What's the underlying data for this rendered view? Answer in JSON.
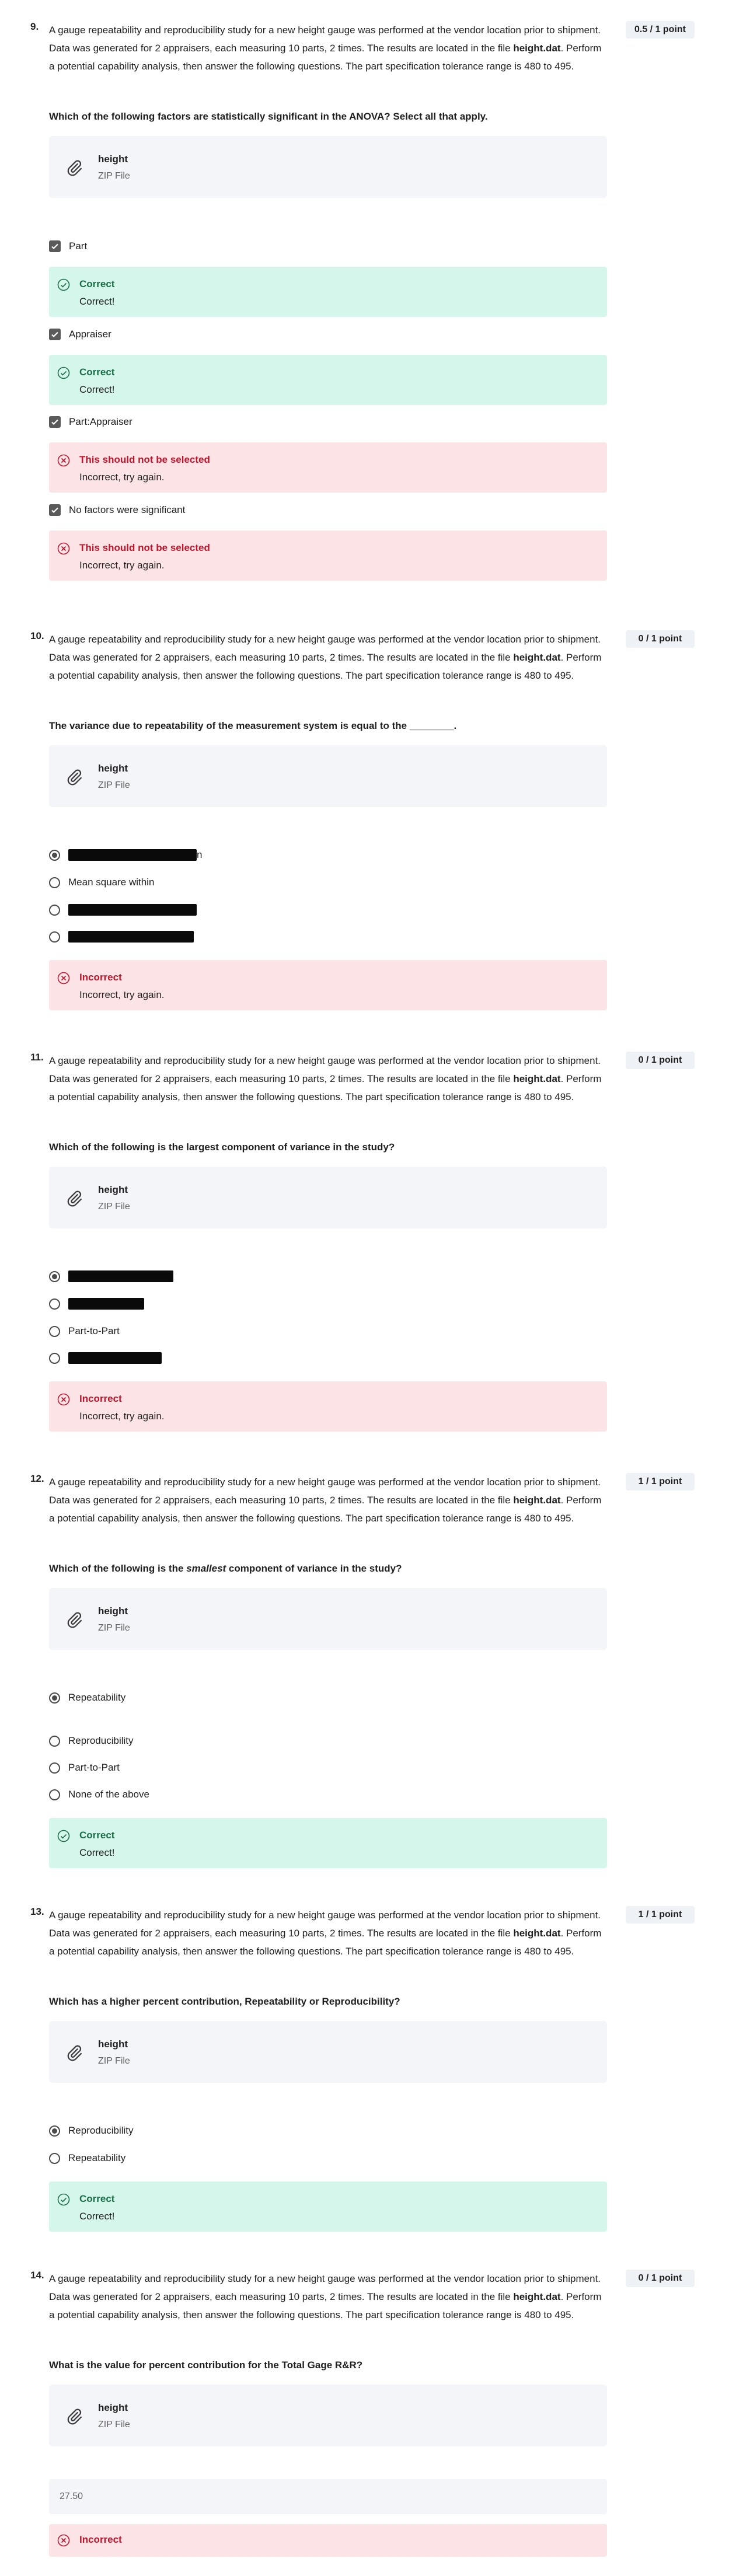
{
  "questions": [
    {
      "number": "9.",
      "score": "0.5 / 1 point",
      "stem": {
        "p1": "A gauge repeatability and reproducibility study for a new height gauge was performed at the vendor location prior to shipment. Data was generated for 2 appraisers, each measuring 10 parts, 2 times. The results are located in the file ",
        "file": "height.dat",
        "p2": ". Perform a potential capability analysis, then answer the following questions. The part specification tolerance range is 480 to 495."
      },
      "prompt": "Which of the following factors are statistically significant in the ANOVA? Select all that apply.",
      "attachment": {
        "name": "height",
        "type": "ZIP File",
        "icon": "paperclip-icon"
      },
      "options": [
        {
          "label": "Part",
          "checked": true
        },
        {
          "label": "Appraiser",
          "checked": true
        },
        {
          "label": "Part:Appraiser",
          "checked": true
        },
        {
          "label": "No factors were significant",
          "checked": true
        }
      ],
      "feedback": [
        {
          "title": "Correct",
          "message": "Correct!",
          "status": "correct"
        },
        {
          "title": "Correct",
          "message": "Correct!",
          "status": "correct"
        },
        {
          "title": "This should not be selected",
          "message": "Incorrect, try again.",
          "status": "incorrect"
        },
        {
          "title": "This should not be selected",
          "message": "Incorrect, try again.",
          "status": "incorrect"
        }
      ]
    },
    {
      "number": "10.",
      "score": "0 / 1 point",
      "stem": {
        "p1": "A gauge repeatability and reproducibility study for a new height gauge was performed at the vendor location prior to shipment. Data was generated for 2 appraisers, each measuring 10 parts, 2 times. The results are located in the file ",
        "file": "height.dat",
        "p2": ". Perform a potential capability analysis, then answer the following questions. The part specification tolerance range is 480 to 495."
      },
      "prompt": "The variance due to repeatability of the measurement system is equal to the ________.",
      "attachment": {
        "name": "height",
        "type": "ZIP File",
        "icon": "paperclip-icon"
      },
      "options": [
        {
          "label": "n",
          "selected": true,
          "redacted": true
        },
        {
          "label": "Mean square within",
          "selected": false
        },
        {
          "label": "",
          "selected": false,
          "redacted": true
        },
        {
          "label": "",
          "selected": false,
          "redacted": true
        }
      ],
      "feedback": {
        "title": "Incorrect",
        "message": "Incorrect, try again.",
        "status": "incorrect"
      }
    },
    {
      "number": "11.",
      "score": "0 / 1 point",
      "stem": {
        "p1": "A gauge repeatability and reproducibility study for a new height gauge was performed at the vendor location prior to shipment. Data was generated for 2 appraisers, each measuring 10 parts, 2 times. The results are located in the file ",
        "file": "height.dat",
        "p2": ". Perform a potential capability analysis, then answer the following questions. The part specification tolerance range is 480 to 495."
      },
      "prompt": "Which of the following is the largest component of variance in the study?",
      "attachment": {
        "name": "height",
        "type": "ZIP File",
        "icon": "paperclip-icon"
      },
      "options": [
        {
          "label": "",
          "selected": true,
          "redacted": true
        },
        {
          "label": "",
          "selected": false,
          "redacted": true
        },
        {
          "label": "Part-to-Part",
          "selected": false
        },
        {
          "label": "",
          "selected": false,
          "redacted": true
        }
      ],
      "feedback": {
        "title": "Incorrect",
        "message": "Incorrect, try again.",
        "status": "incorrect"
      }
    },
    {
      "number": "12.",
      "score": "1 / 1 point",
      "stem": {
        "p1": "A gauge repeatability and reproducibility study for a new height gauge was performed at the vendor location prior to shipment. Data was generated for 2 appraisers, each measuring 10 parts, 2 times. The results are located in the file ",
        "file": "height.dat",
        "p2": ". Perform a potential capability analysis, then answer the following questions. The part specification tolerance range is 480 to 495."
      },
      "prompt_a": "Which of the following is the ",
      "prompt_em": "smallest",
      "prompt_b": " component of variance in the study?",
      "attachment": {
        "name": "height",
        "type": "ZIP File",
        "icon": "paperclip-icon"
      },
      "options": [
        {
          "label": "Repeatability",
          "selected": true
        },
        {
          "label": "Reproducibility",
          "selected": false
        },
        {
          "label": "Part-to-Part",
          "selected": false
        },
        {
          "label": "None of the above",
          "selected": false
        }
      ],
      "feedback": {
        "title": "Correct",
        "message": "Correct!",
        "status": "correct"
      }
    },
    {
      "number": "13.",
      "score": "1 / 1 point",
      "stem": {
        "p1": "A gauge repeatability and reproducibility study for a new height gauge was performed at the vendor location prior to shipment. Data was generated for 2 appraisers, each measuring 10 parts, 2 times. The results are located in the file ",
        "file": "height.dat",
        "p2": ". Perform a potential capability analysis, then answer the following questions. The part specification tolerance range is 480 to 495."
      },
      "prompt": "Which has a higher percent contribution, Repeatability or Reproducibility?",
      "attachment": {
        "name": "height",
        "type": "ZIP File",
        "icon": "paperclip-icon"
      },
      "options": [
        {
          "label": "Reproducibility",
          "selected": true
        },
        {
          "label": "Repeatability",
          "selected": false
        }
      ],
      "feedback": {
        "title": "Correct",
        "message": "Correct!",
        "status": "correct"
      }
    },
    {
      "number": "14.",
      "score": "0 / 1 point",
      "stem": {
        "p1": "A gauge repeatability and reproducibility study for a new height gauge was performed at the vendor location prior to shipment. Data was generated for 2 appraisers, each measuring 10 parts, 2 times. The results are located in the file ",
        "file": "height.dat",
        "p2": ". Perform a potential capability analysis, then answer the following questions. The part specification tolerance range is 480 to 495."
      },
      "prompt": "What is the value for percent contribution for the Total Gage R&R?",
      "attachment": {
        "name": "height",
        "type": "ZIP File",
        "icon": "paperclip-icon"
      },
      "answer_value": "27.50",
      "feedback": {
        "title": "Incorrect",
        "status": "incorrect"
      }
    }
  ],
  "colors": {
    "correct_bg": "#d5f6ea",
    "correct_text": "#1b6e4a",
    "incorrect_bg": "#fce3e6",
    "incorrect_text": "#c0152b",
    "score_bg": "#eef1f6",
    "attachment_bg": "#f3f5f9"
  }
}
